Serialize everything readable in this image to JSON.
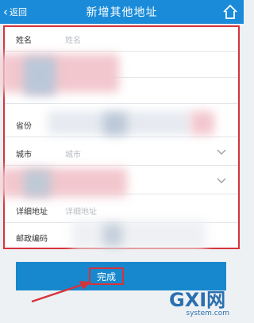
{
  "header": {
    "back_label": "返回",
    "title": "新增其他地址",
    "home_icon": "home-icon"
  },
  "form": {
    "rows": [
      {
        "label": "姓名",
        "placeholder": "姓名"
      },
      {
        "label": "",
        "placeholder": ""
      },
      {
        "label": "",
        "placeholder": ""
      },
      {
        "label": "省份",
        "placeholder": ""
      },
      {
        "label": "城市",
        "placeholder": "城市"
      },
      {
        "label": "",
        "placeholder": ""
      },
      {
        "label": "详细地址",
        "placeholder": "详细地址"
      },
      {
        "label": "邮政编码",
        "placeholder": ""
      }
    ]
  },
  "submit": {
    "label": "完成"
  },
  "watermark": {
    "logo": "GXI网",
    "sub": "system.com"
  },
  "colors": {
    "header_bg": "#1a8bd9",
    "accent_red": "#d7333a",
    "button_bg": "#1788cd"
  }
}
